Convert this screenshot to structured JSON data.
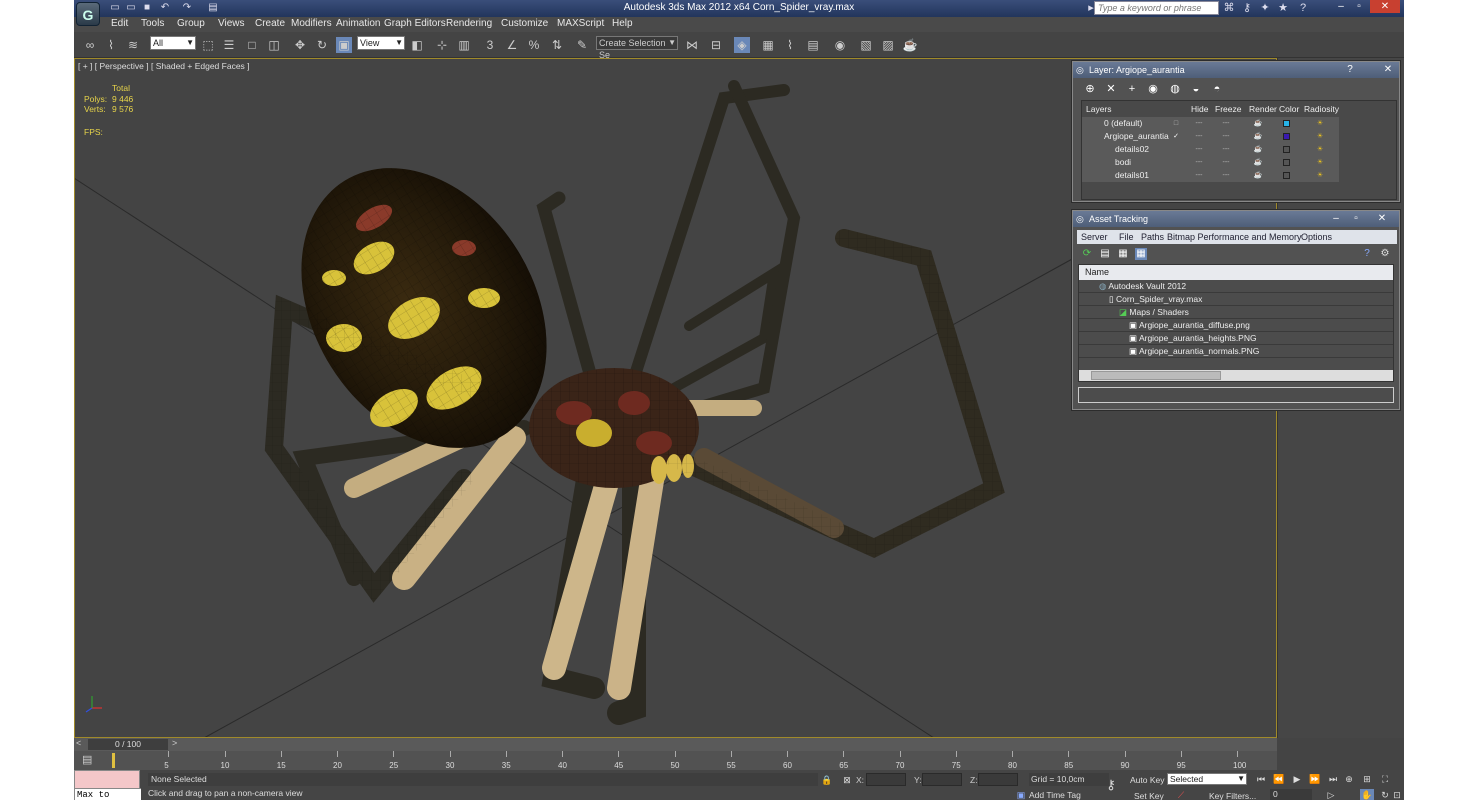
{
  "app": {
    "logo": "G",
    "window_title": "Autodesk 3ds Max  2012 x64      Corn_Spider_vray.max",
    "search_placeholder": "Type a keyword or phrase"
  },
  "menu": {
    "items": [
      "Edit",
      "Tools",
      "Group",
      "Views",
      "Create",
      "Modifiers",
      "Animation",
      "Graph Editors",
      "Rendering",
      "Customize",
      "MAXScript",
      "Help"
    ]
  },
  "toolbar": {
    "filter_value": "All",
    "view_value": "View",
    "selection_set_value": "Create Selection Se"
  },
  "viewport": {
    "label": "[ + ] [ Perspective ] [ Shaded + Edged Faces ]",
    "stats": {
      "total_label": "Total",
      "polys_label": "Polys:",
      "polys_value": "9 446",
      "verts_label": "Verts:",
      "verts_value": "9 576",
      "fps_label": "FPS:"
    }
  },
  "layer_dialog": {
    "title": "Layer: Argiope_aurantia",
    "columns": [
      "Layers",
      "Hide",
      "Freeze",
      "Render",
      "Color",
      "Radiosity"
    ],
    "rows": [
      {
        "name": "0 (default)",
        "color": "#27b4e8",
        "current": false
      },
      {
        "name": "Argiope_aurantia",
        "color": "#3a1ab0",
        "current": true
      },
      {
        "name": "details02",
        "color": "#555555",
        "current": false
      },
      {
        "name": "bodi",
        "color": "#555555",
        "current": false
      },
      {
        "name": "details01",
        "color": "#555555",
        "current": false
      }
    ]
  },
  "asset_dialog": {
    "title": "Asset Tracking",
    "menu": [
      "Server",
      "File",
      "Paths",
      "Bitmap Performance and Memory",
      "Options"
    ],
    "column_name": "Name",
    "rows": [
      "Autodesk Vault 2012",
      "Corn_Spider_vray.max",
      "Maps / Shaders",
      "Argiope_aurantia_diffuse.png",
      "Argiope_aurantia_heights.PNG",
      "Argiope_aurantia_normals.PNG"
    ]
  },
  "timeline": {
    "frame_label": "0 / 100",
    "ticks": [
      "5",
      "10",
      "15",
      "20",
      "25",
      "30",
      "35",
      "40",
      "45",
      "50",
      "55",
      "60",
      "65",
      "70",
      "75",
      "80",
      "85",
      "90",
      "95",
      "100"
    ]
  },
  "status": {
    "maxscript_text": "Max to Physc:",
    "selection": "None Selected",
    "prompt": "Click and drag to pan a non-camera view",
    "x_label": "X:",
    "y_label": "Y:",
    "z_label": "Z:",
    "grid": "Grid = 10,0cm",
    "add_time_tag": "Add Time Tag",
    "auto_key": "Auto Key",
    "set_key": "Set Key",
    "selected_combo": "Selected",
    "key_filters": "Key Filters...",
    "frame": "0"
  }
}
